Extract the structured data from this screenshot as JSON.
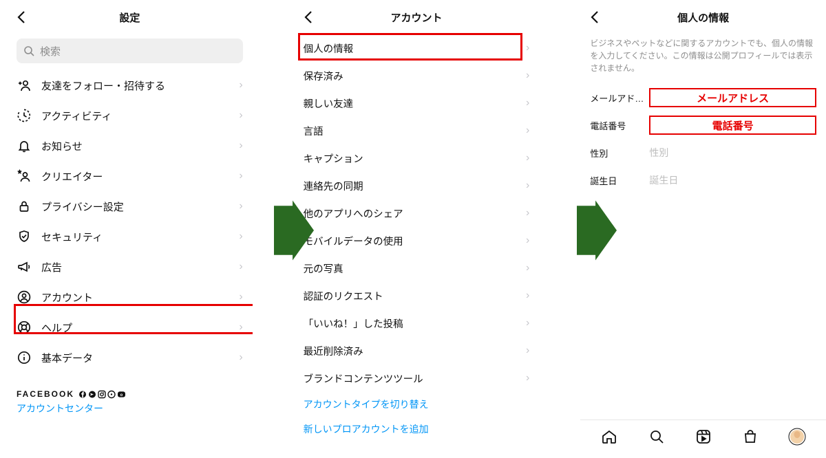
{
  "screen1": {
    "title": "設定",
    "search_placeholder": "検索",
    "items": [
      {
        "label": "友達をフォロー・招待する"
      },
      {
        "label": "アクティビティ"
      },
      {
        "label": "お知らせ"
      },
      {
        "label": "クリエイター"
      },
      {
        "label": "プライバシー設定"
      },
      {
        "label": "セキュリティ"
      },
      {
        "label": "広告"
      },
      {
        "label": "アカウント"
      },
      {
        "label": "ヘルプ"
      },
      {
        "label": "基本データ"
      }
    ],
    "facebook_label": "FACEBOOK",
    "account_center_label": "アカウントセンター"
  },
  "screen2": {
    "title": "アカウント",
    "items": [
      {
        "label": "個人の情報"
      },
      {
        "label": "保存済み"
      },
      {
        "label": "親しい友達"
      },
      {
        "label": "言語"
      },
      {
        "label": "キャプション"
      },
      {
        "label": "連絡先の同期"
      },
      {
        "label": "他のアプリへのシェア"
      },
      {
        "label": "モバイルデータの使用"
      },
      {
        "label": "元の写真"
      },
      {
        "label": "認証のリクエスト"
      },
      {
        "label": "「いいね！」した投稿"
      },
      {
        "label": "最近削除済み"
      },
      {
        "label": "ブランドコンテンツツール"
      }
    ],
    "switch_account_type": "アカウントタイプを切り替え",
    "add_pro_account": "新しいプロアカウントを追加"
  },
  "screen3": {
    "title": "個人の情報",
    "description": "ビジネスやペットなどに関するアカウントでも、個人の情報を入力してください。この情報は公開プロフィールでは表示されません。",
    "fields": {
      "email_label": "メールアド…",
      "email_box": "メールアドレス",
      "phone_label": "電話番号",
      "phone_box": "電話番号",
      "gender_label": "性別",
      "gender_placeholder": "性別",
      "birthday_label": "誕生日",
      "birthday_placeholder": "誕生日"
    }
  },
  "colors": {
    "highlight": "#e60000",
    "arrow": "#2a6a22",
    "link": "#0095f6"
  }
}
